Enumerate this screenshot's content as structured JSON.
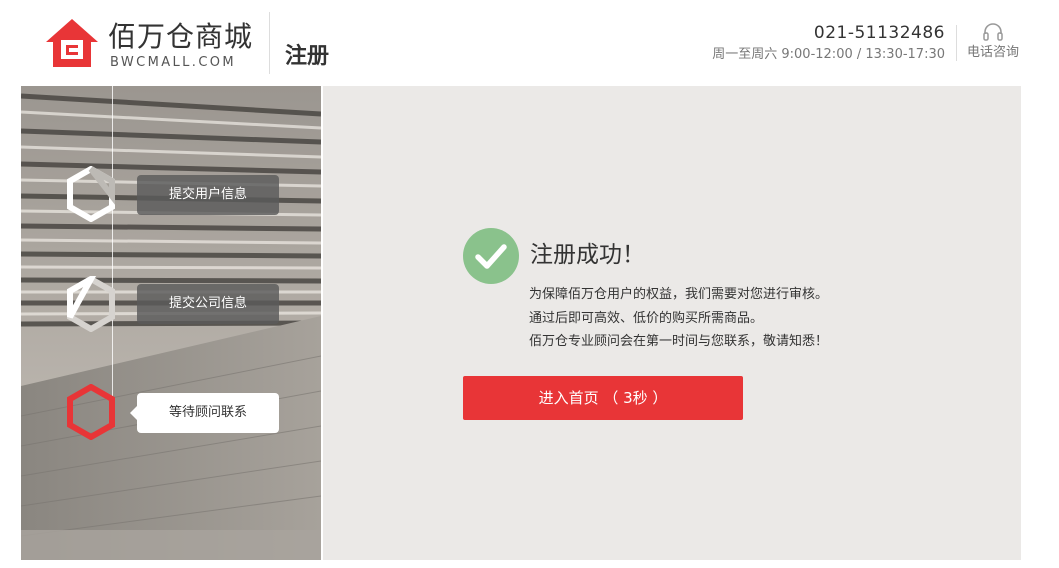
{
  "brand": {
    "name_cn": "佰万仓商城",
    "domain": "BWCMALL.COM",
    "accent_color": "#e83537"
  },
  "header": {
    "page_title": "注册",
    "phone": "021-51132486",
    "hours": "周一至周六 9:00-12:00 / 13:30-17:30",
    "consult_label": "电话咨询",
    "consult_icon": "headset-icon"
  },
  "steps": [
    {
      "label": "提交用户信息",
      "state": "done"
    },
    {
      "label": "提交公司信息",
      "state": "done"
    },
    {
      "label": "等待顾问联系",
      "state": "current"
    }
  ],
  "result": {
    "icon": "check-circle-icon",
    "icon_color": "#8ac28c",
    "title": "注册成功！",
    "lines": [
      "为保障佰万仓用户的权益，我们需要对您进行审核。",
      "通过后即可高效、低价的购买所需商品。",
      "佰万仓专业顾问会在第一时间与您联系，敬请知悉！"
    ],
    "button_label": "进入首页 （ 3秒 ）"
  }
}
